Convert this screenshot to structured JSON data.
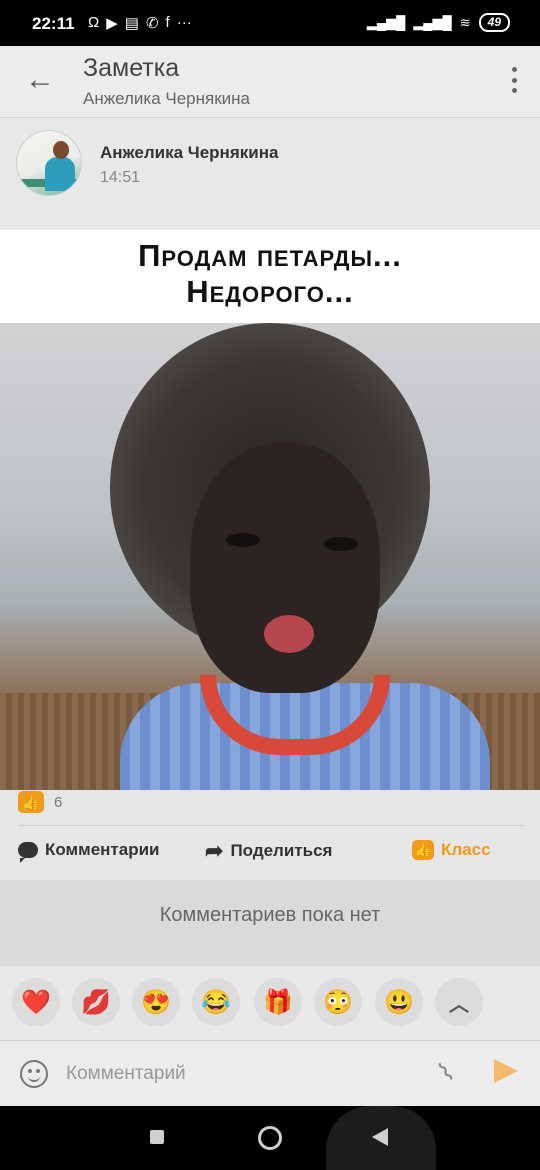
{
  "status_bar": {
    "time": "22:11",
    "left_icons": [
      "headphones-icon",
      "play-store-icon",
      "message-icon",
      "whatsapp-icon",
      "facebook-icon",
      "more-icon"
    ],
    "left_glyphs": [
      "Ω",
      "▶",
      "▤",
      "✆",
      "f",
      "···"
    ],
    "signal_1": "▂▄▆█",
    "signal_2": "▂▄▆█",
    "wifi": "≋",
    "battery": "49"
  },
  "app_bar": {
    "back_glyph": "←",
    "title": "Заметка",
    "subtitle": "Анжелика Чернякина"
  },
  "post": {
    "author": "Анжелика Чернякина",
    "time": "14:51",
    "caption_lines": [
      "Продам петарды...",
      "Недорого..."
    ]
  },
  "footer": {
    "like_glyph": "👍",
    "like_count": "6",
    "comments_label": "Комментарии",
    "share_glyph": "➦",
    "share_label": "Поделиться",
    "klass_label": "Класс"
  },
  "comments": {
    "empty_text": "Комментариев пока нет"
  },
  "reactions": {
    "items": [
      {
        "name": "heart-reaction",
        "glyph": "❤️"
      },
      {
        "name": "kiss-reaction",
        "glyph": "💋"
      },
      {
        "name": "heart-eyes-reaction",
        "glyph": "😍"
      },
      {
        "name": "laugh-reaction",
        "glyph": "😂"
      },
      {
        "name": "gift-reaction",
        "glyph": "🎁"
      },
      {
        "name": "flushed-reaction",
        "glyph": "😳"
      },
      {
        "name": "grin-reaction",
        "glyph": "😃"
      }
    ],
    "expand_glyph": "︿"
  },
  "composer": {
    "placeholder": "Комментарий",
    "attach_glyph": "⌇"
  },
  "colors": {
    "accent": "#f29a1a",
    "send_inactive": "#f2b870"
  }
}
